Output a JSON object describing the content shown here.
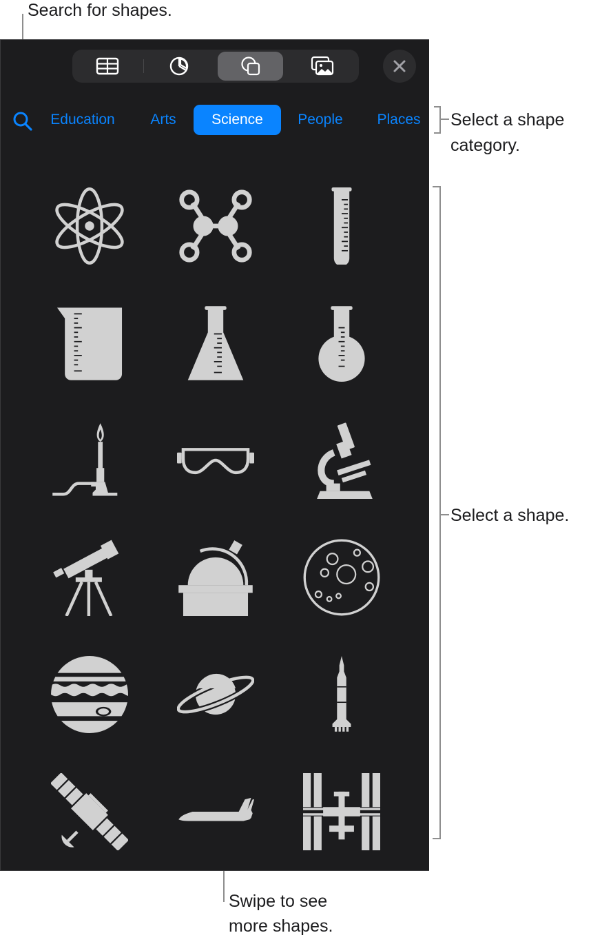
{
  "callouts": {
    "search": "Search for shapes.",
    "category_line1": "Select a shape",
    "category_line2": "category.",
    "shape": "Select a shape.",
    "swipe_line1": "Swipe to see",
    "swipe_line2": "more shapes."
  },
  "toolbar": {
    "tabs": [
      {
        "icon": "table-icon",
        "active": false
      },
      {
        "icon": "chart-icon",
        "active": false
      },
      {
        "icon": "shapes-icon",
        "active": true
      },
      {
        "icon": "media-icon",
        "active": false
      }
    ],
    "close_icon": "close-icon"
  },
  "categories": {
    "search_icon": "search-icon",
    "items": [
      {
        "label": "Education",
        "active": false
      },
      {
        "label": "Arts",
        "active": false
      },
      {
        "label": "Science",
        "active": true
      },
      {
        "label": "People",
        "active": false
      },
      {
        "label": "Places",
        "active": false
      }
    ]
  },
  "shapes": [
    "atom",
    "molecule",
    "test-tube",
    "beaker",
    "erlenmeyer-flask",
    "round-bottom-flask",
    "bunsen-burner",
    "safety-goggles",
    "microscope",
    "telescope",
    "observatory",
    "petri-dish",
    "jupiter",
    "saturn",
    "rocket",
    "satellite",
    "space-shuttle",
    "space-station"
  ],
  "colors": {
    "panel_bg": "#1c1c1e",
    "accent": "#0a84ff",
    "shape_fill": "#d1d1d1",
    "segment_bg": "#2c2c2e",
    "segment_active": "#636366"
  }
}
